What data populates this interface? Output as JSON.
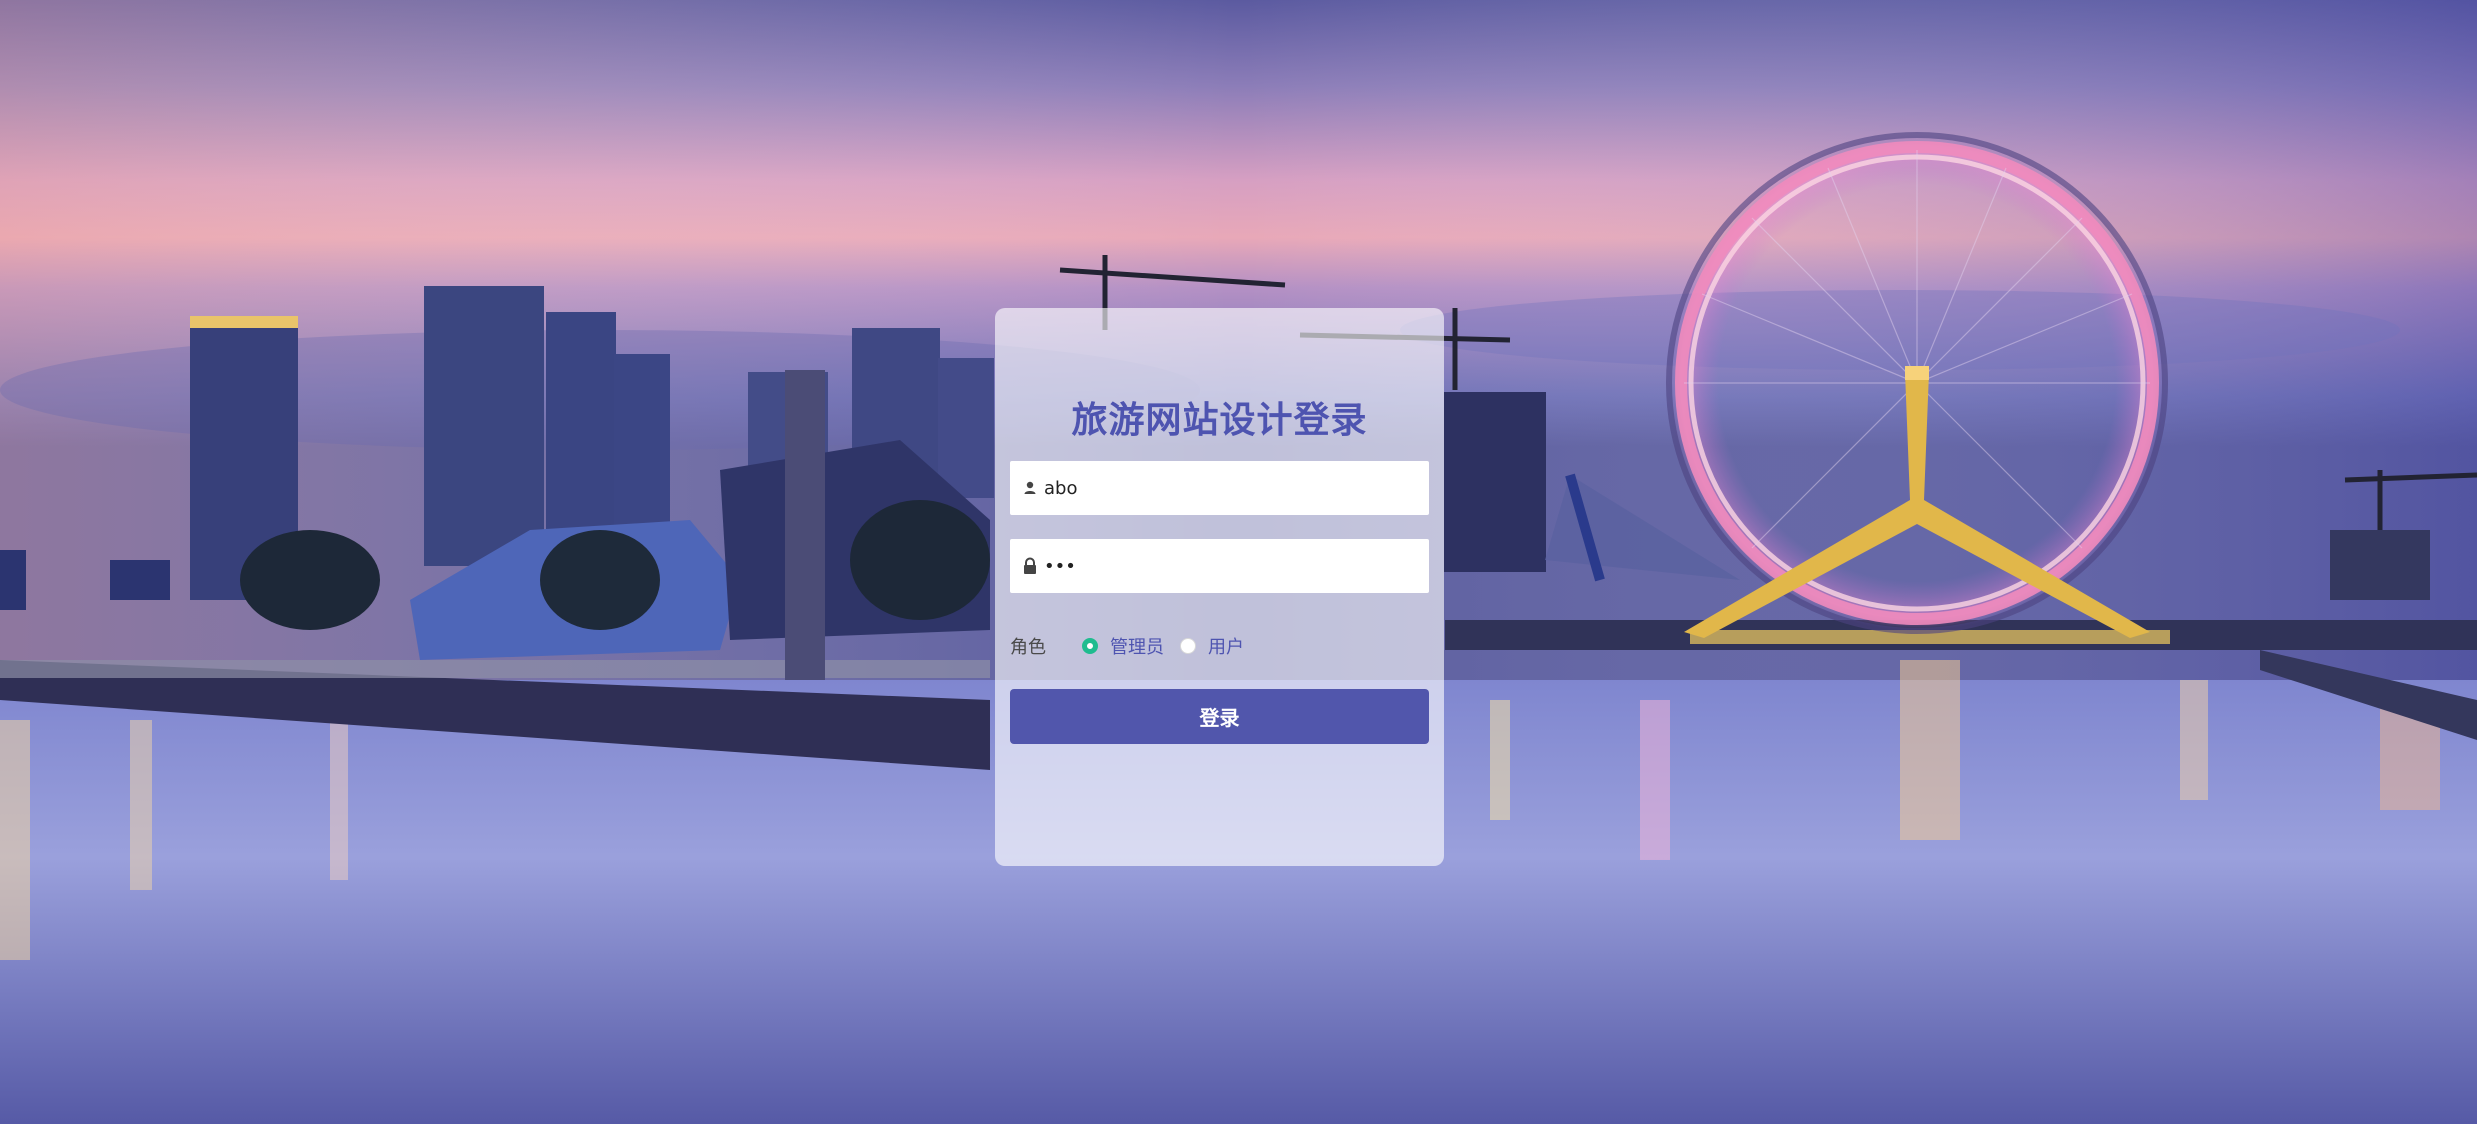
{
  "login": {
    "title": "旅游网站设计登录",
    "username": {
      "value": "abo",
      "icon": "user-icon"
    },
    "password": {
      "value": "•••",
      "icon": "lock-icon"
    },
    "role": {
      "label": "角色",
      "options": [
        {
          "label": "管理员",
          "checked": true
        },
        {
          "label": "用户",
          "checked": false
        }
      ]
    },
    "submit_label": "登录"
  },
  "colors": {
    "accent": "#5156ac",
    "title": "#4e54b0",
    "radio_checked": "#1fbc8f"
  }
}
